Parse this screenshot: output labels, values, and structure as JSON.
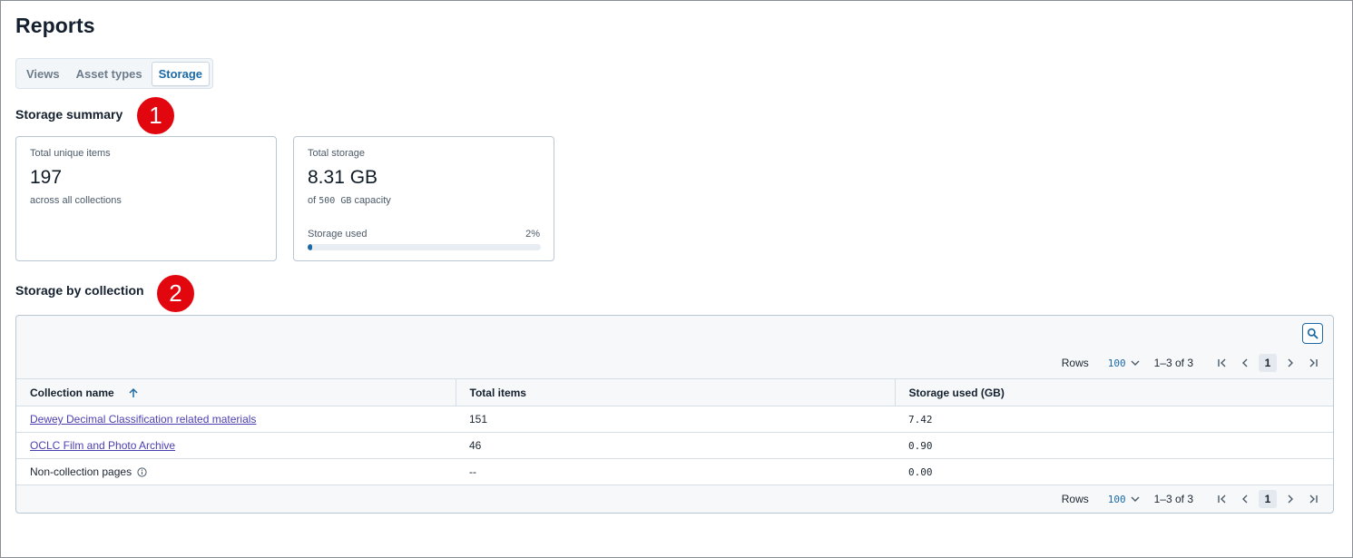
{
  "page": {
    "title": "Reports"
  },
  "tabs": [
    {
      "label": "Views",
      "active": false
    },
    {
      "label": "Asset types",
      "active": false
    },
    {
      "label": "Storage",
      "active": true
    }
  ],
  "summary": {
    "title": "Storage summary",
    "badge": "1",
    "items_card": {
      "label": "Total unique items",
      "value": "197",
      "sub": "across all collections"
    },
    "storage_card": {
      "label": "Total storage",
      "value": "8.31 GB",
      "sub_prefix": "of",
      "sub_capacity": "500 GB",
      "sub_suffix": "capacity",
      "bar_label": "Storage used",
      "bar_pct": "2%",
      "bar_fraction": 0.02
    }
  },
  "collection": {
    "title": "Storage by collection",
    "badge": "2",
    "search_icon": "search-icon",
    "pager": {
      "rows_label": "Rows",
      "rows_value": "100",
      "range": "1–3 of 3",
      "current_page": "1"
    },
    "columns": [
      "Collection name",
      "Total items",
      "Storage used (GB)"
    ],
    "rows": [
      {
        "name": "Dewey Decimal Classification related materials",
        "items": "151",
        "storage": "7.42",
        "link": true
      },
      {
        "name": "OCLC Film and Photo Archive",
        "items": "46",
        "storage": "0.90",
        "link": true
      },
      {
        "name": "Non-collection pages",
        "items": "--",
        "storage": "0.00",
        "link": false
      }
    ]
  },
  "colors": {
    "accent": "#1c6aa5",
    "badge": "#e2060e",
    "link": "#4a3fb0"
  }
}
